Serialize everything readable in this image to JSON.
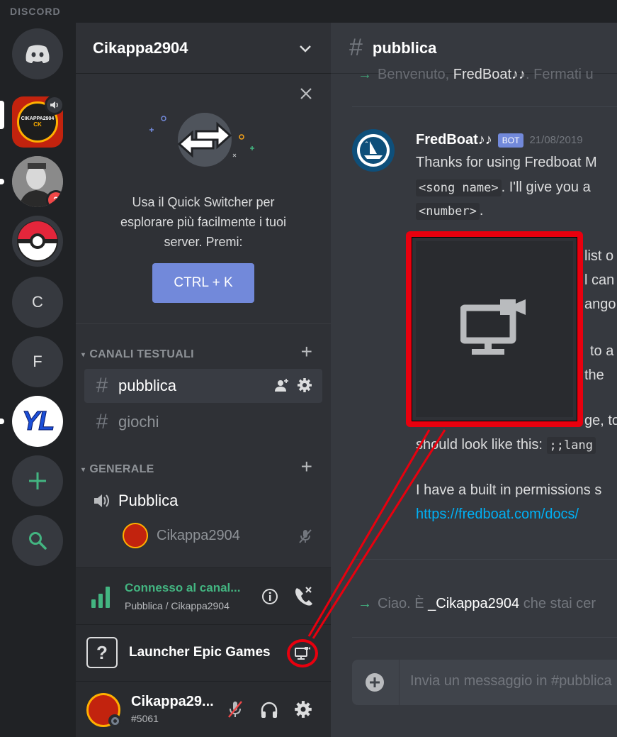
{
  "app": {
    "brand": "DISCORD"
  },
  "server": {
    "name": "Cikappa2904"
  },
  "guilds": [
    {
      "label": "CIKAPPA2904",
      "sub": "CK"
    },
    {
      "badge": "2"
    },
    {
      "label": "C"
    },
    {
      "label": "F"
    },
    {
      "label": "YL"
    }
  ],
  "quick_switcher": {
    "text": "Usa il Quick Switcher per esplorare più facilmente i tuoi server. Premi:",
    "button": "CTRL + K"
  },
  "categories": {
    "text": "CANALI TESTUALI",
    "general": "GENERALE"
  },
  "channels": {
    "pubblica": "pubblica",
    "giochi": "giochi",
    "voice": "Pubblica"
  },
  "voice_user": {
    "name": "Cikappa2904"
  },
  "voice_panel": {
    "title": "Connesso al canal...",
    "subtitle": "Pubblica / Cikappa2904"
  },
  "activity": {
    "name": "Launcher Epic Games"
  },
  "user": {
    "name": "Cikappa29...",
    "tag": "#5061"
  },
  "chat": {
    "channel": "pubblica",
    "top_line_prefix": "Benvenuto,",
    "top_line_user": "FredBoat♪♪",
    "top_line_suffix": ". Fermati u",
    "author": "FredBoat♪♪",
    "bot_badge": "BOT",
    "timestamp": "21/08/2019",
    "line1": "Thanks for using Fredboat M",
    "line2_code": "<song name>",
    "line2_text": ". I'll give you a",
    "line3_code": "<number>",
    "line3_text": ".",
    "frag1": "list o",
    "frag2": "l can",
    "frag3": "ango",
    "frag4": "to a",
    "frag5": "the",
    "frag6": "ge, to",
    "line_lang_text": "should look like this:",
    "line_lang_code": ";;lang",
    "perm_line": "I have a built in permissions s",
    "link": "https://fredboat.com/docs/",
    "bottom_line_prefix": "Ciao. È",
    "bottom_line_user": "_Cikappa2904",
    "bottom_line_suffix": "che stai cer",
    "composer_placeholder": "Invia un messaggio in #pubblica"
  },
  "colors": {
    "accent": "#7289da",
    "green": "#43b581",
    "red": "#f04747",
    "highlight": "#e8000e"
  }
}
